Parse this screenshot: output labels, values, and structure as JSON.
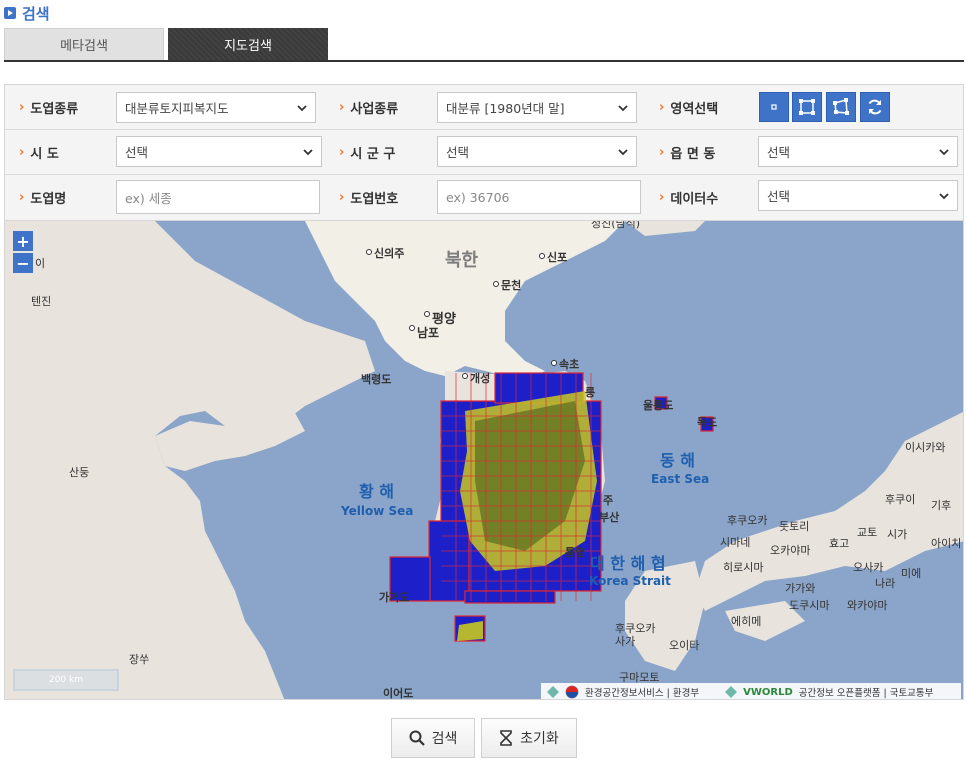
{
  "header": {
    "title": "검색"
  },
  "tabs": [
    {
      "label": "메타검색",
      "active": false
    },
    {
      "label": "지도검색",
      "active": true
    }
  ],
  "form": {
    "map_type": {
      "label": "도엽종류",
      "value": "대분류토지피복지도"
    },
    "project_type": {
      "label": "사업종류",
      "value": "대분류 [1980년대 말]"
    },
    "area_select": {
      "label": "영역선택"
    },
    "sido": {
      "label": "시 도",
      "value": "선택"
    },
    "sigungu": {
      "label": "시 군 구",
      "value": "선택"
    },
    "eupmyeondong": {
      "label": "읍 면 동",
      "value": "선택"
    },
    "sheet_name": {
      "label": "도엽명",
      "placeholder": "ex) 세종"
    },
    "sheet_number": {
      "label": "도엽번호",
      "placeholder": "ex) 36706"
    },
    "data_count": {
      "label": "데이터수",
      "value": "선택"
    }
  },
  "map": {
    "zoom_in": "+",
    "zoom_out": "−",
    "scale": "200 km",
    "labels": {
      "sinuiju": "신의주",
      "north_korea": "북한",
      "sinpo": "신포",
      "muncheon": "문천",
      "pyongyang": "평양",
      "nampo": "남포",
      "sokcho": "속초",
      "baengnyeongdo": "백령도",
      "gaeseong": "개성",
      "ulleungdo": "울릉도",
      "dokdo": "독도",
      "east_sea_ko": "동 해",
      "east_sea_en": "East Sea",
      "yellow_sea_ko": "황 해",
      "yellow_sea_en": "Yellow Sea",
      "korea_strait_ko": "대 한 해 협",
      "korea_strait_en": "Korea Strait",
      "shandong": "산둥",
      "jangsu": "장쑤",
      "gageodo": "가거도",
      "ieodo": "이어도",
      "tianjin": "텐진",
      "ninghai": "이",
      "chongjin": "청진(남석)",
      "isikawa": "이시카와",
      "fukui": "후쿠이",
      "gifu": "기후",
      "fukuoka": "후쿠오카",
      "tottori": "돗토리",
      "shimane": "시마네",
      "okayama": "오카야마",
      "hiroshima": "히로시마",
      "hyogo": "효고",
      "kyoto": "교토",
      "shiga": "시가",
      "aichi": "아이치",
      "osaka": "오사카",
      "mie": "미에",
      "nara": "나라",
      "kagawa": "가가와",
      "tokushima": "도쿠시마",
      "wakayama": "와카야마",
      "ehime": "에히메",
      "fukuoka2": "후쿠오카",
      "saga": "사가",
      "oita": "오이타",
      "kumamoto": "구마모토",
      "busan": "부산",
      "tongyeong": "통영",
      "gangneung": "릉",
      "ju": "주"
    },
    "attribution": {
      "left": "환경공간정보서비스 | 환경부",
      "brand": "VWORLD",
      "right": "공간정보 오픈플랫폼 | 국토교통부"
    }
  },
  "buttons": {
    "search": "검색",
    "reset": "초기화"
  }
}
